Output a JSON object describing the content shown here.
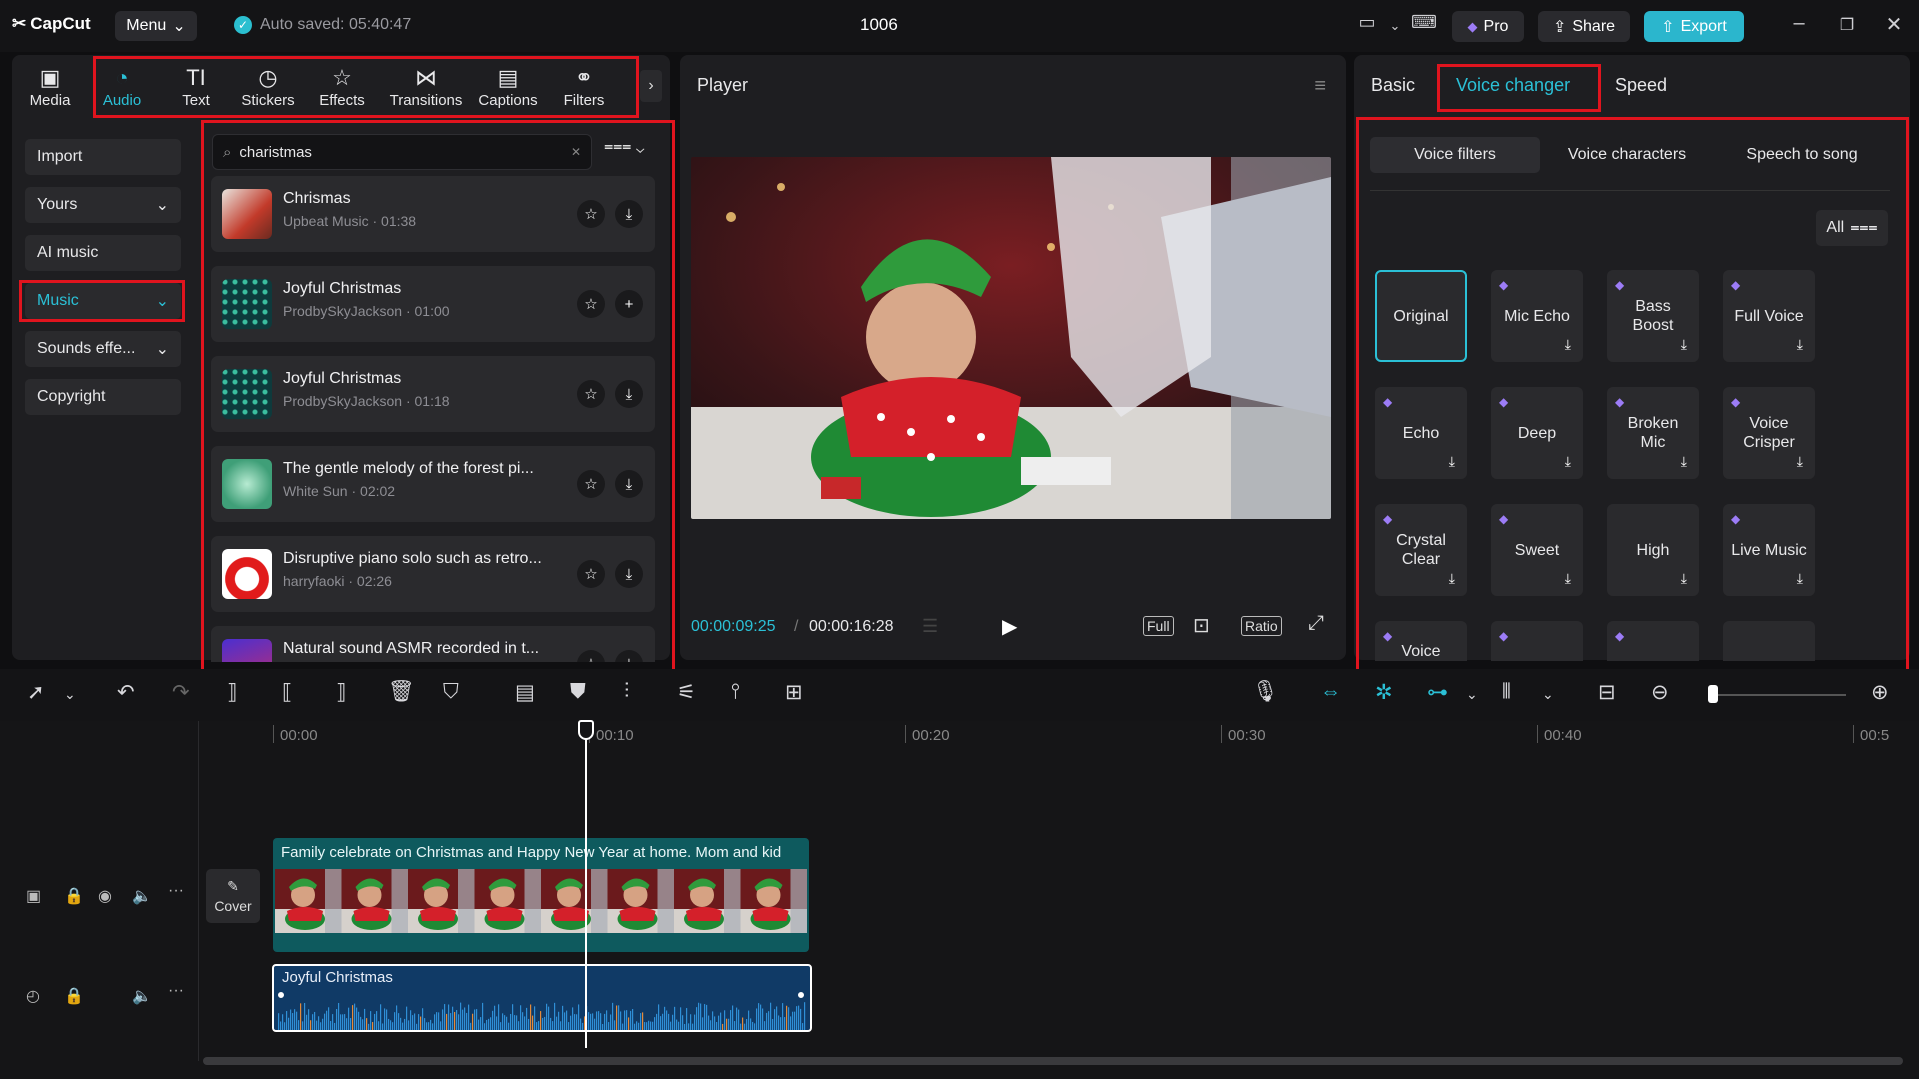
{
  "app": {
    "logo": "CapCut",
    "menu_label": "Menu",
    "autosave": "Auto saved: 05:40:47",
    "project_title": "1006",
    "pro_label": "Pro",
    "share_label": "Share",
    "export_label": "Export"
  },
  "tool_tabs": [
    {
      "label": "Media",
      "icon": "media-icon"
    },
    {
      "label": "Audio",
      "icon": "audio-icon",
      "active": true
    },
    {
      "label": "Text",
      "icon": "text-icon"
    },
    {
      "label": "Stickers",
      "icon": "stickers-icon"
    },
    {
      "label": "Effects",
      "icon": "effects-icon"
    },
    {
      "label": "Transitions",
      "icon": "transitions-icon"
    },
    {
      "label": "Captions",
      "icon": "captions-icon"
    },
    {
      "label": "Filters",
      "icon": "filters-icon"
    }
  ],
  "audio_sidebar": [
    {
      "label": "Import"
    },
    {
      "label": "Yours",
      "chevron": true
    },
    {
      "label": "AI music"
    },
    {
      "label": "Music",
      "chevron": true,
      "active": true
    },
    {
      "label": "Sounds effe...",
      "chevron": true
    },
    {
      "label": "Copyright"
    }
  ],
  "search": {
    "value": "charistmas"
  },
  "tracks": [
    {
      "name": "Chrismas",
      "meta": "Upbeat Music · 01:38",
      "action": "download"
    },
    {
      "name": "Joyful Christmas",
      "meta": "ProdbySkyJackson · 01:00",
      "action": "add"
    },
    {
      "name": "Joyful Christmas",
      "meta": "ProdbySkyJackson · 01:18",
      "action": "download"
    },
    {
      "name": "The gentle melody of the forest pi...",
      "meta": "White Sun · 02:02",
      "action": "download"
    },
    {
      "name": "Disruptive piano solo such as retro...",
      "meta": "harryfaoki · 02:26",
      "action": "download"
    },
    {
      "name": "Natural sound ASMR recorded in t...",
      "meta": "",
      "action": "download"
    }
  ],
  "player": {
    "title": "Player",
    "current_time": "00:00:09:25",
    "total_time": "00:00:16:28",
    "full_label": "Full",
    "ratio_label": "Ratio"
  },
  "right_panel": {
    "tabs": [
      "Basic",
      "Voice changer",
      "Speed"
    ],
    "active_tab": "Voice changer",
    "subtabs": [
      "Voice filters",
      "Voice characters",
      "Speech to song"
    ],
    "active_subtab": "Voice filters",
    "filter_label": "All",
    "voice_filters": [
      {
        "label": "Original",
        "selected": true,
        "pro": false,
        "download": false
      },
      {
        "label": "Mic Echo",
        "pro": true,
        "download": true
      },
      {
        "label": "Bass Boost",
        "pro": true,
        "download": true
      },
      {
        "label": "Full Voice",
        "pro": true,
        "download": true
      },
      {
        "label": "Echo",
        "pro": true,
        "download": true
      },
      {
        "label": "Deep",
        "pro": true,
        "download": true
      },
      {
        "label": "Broken Mic",
        "pro": true,
        "download": true
      },
      {
        "label": "Voice Crisper",
        "pro": true,
        "download": true
      },
      {
        "label": "Crystal Clear",
        "pro": true,
        "download": true
      },
      {
        "label": "Sweet",
        "pro": true,
        "download": true
      },
      {
        "label": "High",
        "pro": false,
        "download": true
      },
      {
        "label": "Live Music",
        "pro": true,
        "download": true
      },
      {
        "label": "Voice",
        "pro": true,
        "download": false
      },
      {
        "label": "",
        "pro": true,
        "download": false
      },
      {
        "label": "",
        "pro": true,
        "download": false
      },
      {
        "label": "",
        "pro": false,
        "download": false
      }
    ]
  },
  "timeline": {
    "ruler": [
      "00:00",
      "00:10",
      "00:20",
      "00:30",
      "00:40",
      "00:5"
    ],
    "cover_label": "Cover",
    "video_clip_caption": "Family celebrate on Christmas and Happy New Year at home. Mom and kid",
    "audio_clip_label": "Joyful Christmas"
  },
  "colors": {
    "accent": "#2bc0d6",
    "highlight": "#e0141e",
    "pro_gem": "#9c7cf6"
  }
}
